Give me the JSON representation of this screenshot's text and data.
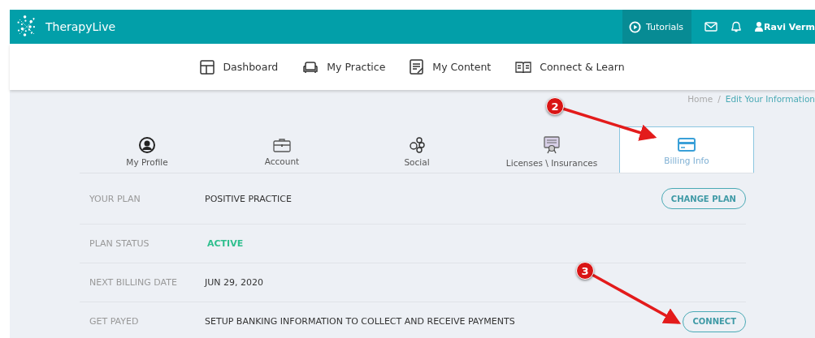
{
  "header": {
    "brand": "TherapyLive",
    "tutorials": "Tutorials",
    "user": "Ravi Verm"
  },
  "nav": [
    {
      "label": "Dashboard",
      "kind": "dashboard"
    },
    {
      "label": "My Practice",
      "kind": "practice"
    },
    {
      "label": "My Content",
      "kind": "content"
    },
    {
      "label": "Connect & Learn",
      "kind": "learn"
    }
  ],
  "breadcrumb": {
    "home": "Home",
    "separator": "/",
    "current": "Edit Your Information"
  },
  "tabs": [
    {
      "label": "My Profile",
      "kind": "profile",
      "selected": false
    },
    {
      "label": "Account",
      "kind": "account",
      "selected": false
    },
    {
      "label": "Social",
      "kind": "social",
      "selected": false
    },
    {
      "label": "Licenses \\ Insurances",
      "kind": "license",
      "selected": false
    },
    {
      "label": "Billing Info",
      "kind": "billing",
      "selected": true
    }
  ],
  "rows": [
    {
      "label": "YOUR PLAN",
      "value": "POSITIVE PRACTICE",
      "kind": "text",
      "button": "CHANGE PLAN"
    },
    {
      "label": "PLAN STATUS",
      "value": "ACTIVE",
      "kind": "status"
    },
    {
      "label": "NEXT BILLING DATE",
      "value": "JUN 29, 2020",
      "kind": "text"
    },
    {
      "label": "GET PAYED",
      "value": "SETUP BANKING INFORMATION TO COLLECT AND RECEIVE PAYMENTS",
      "kind": "text",
      "button": "CONNECT"
    }
  ],
  "annotations": [
    {
      "number": "2"
    },
    {
      "number": "3"
    }
  ]
}
